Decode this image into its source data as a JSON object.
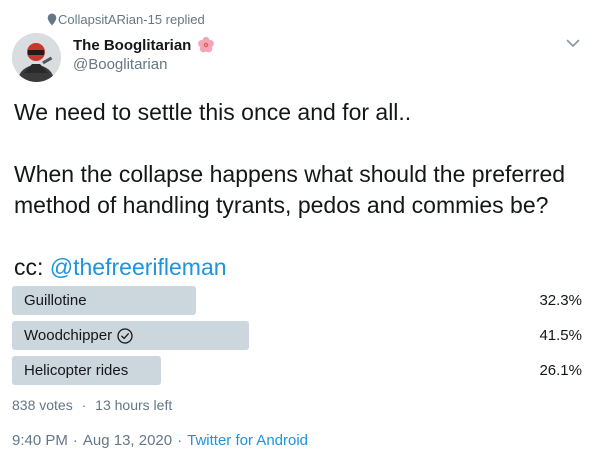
{
  "context": {
    "text": "CollapsitARian-15 replied"
  },
  "author": {
    "display_name": "The Booglitarian",
    "handle": "@Booglitarian",
    "name_emoji": "hibiscus-icon"
  },
  "tweet": {
    "line1": "We need to settle this once and for all..",
    "line2": "When the collapse happens what should the preferred method of handling tyrants, pedos and commies be?",
    "cc_prefix": "cc: ",
    "mention": "@thefreerifleman"
  },
  "poll": {
    "options": [
      {
        "label": "Guillotine",
        "percent": "32.3%",
        "value": 32.3,
        "selected": false
      },
      {
        "label": "Woodchipper",
        "percent": "41.5%",
        "value": 41.5,
        "selected": true
      },
      {
        "label": "Helicopter rides",
        "percent": "26.1%",
        "value": 26.1,
        "selected": false
      }
    ],
    "votes": "838 votes",
    "time_left": "13 hours left",
    "separator": "·"
  },
  "meta": {
    "time": "9:40 PM",
    "date": "Aug 13, 2020",
    "source": "Twitter for Android",
    "separator": "·"
  },
  "colors": {
    "link": "#1b95e0",
    "bar": "#ccd6dd",
    "muted": "#657786",
    "text": "#14171a"
  }
}
